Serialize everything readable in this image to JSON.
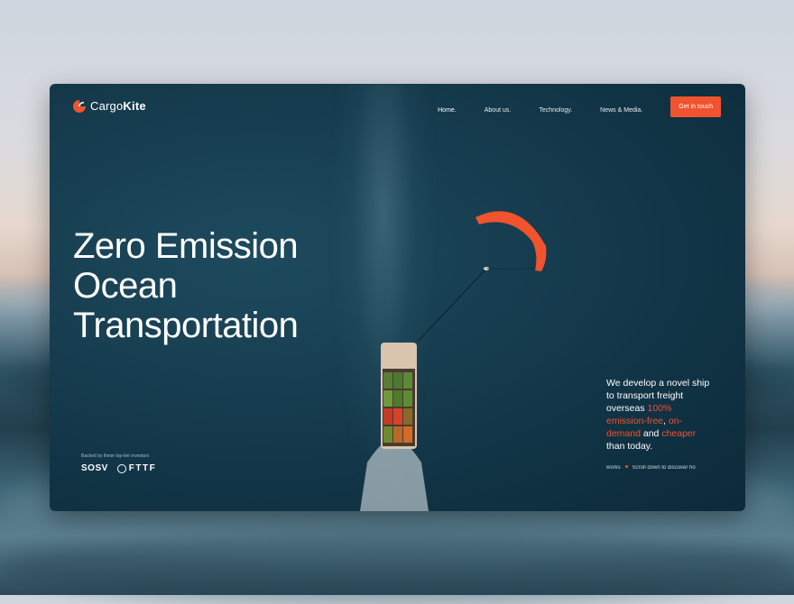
{
  "brand": {
    "name_light": "Cargo",
    "name_bold": "Kite",
    "icon": "cargokite-logo-icon",
    "accent": "#f0532e"
  },
  "nav": {
    "items": [
      {
        "label": "Home.",
        "active": true
      },
      {
        "label": "About us.",
        "active": false
      },
      {
        "label": "Technology.",
        "active": false
      },
      {
        "label": "News & Media.",
        "active": false
      }
    ],
    "cta": "Get in touch"
  },
  "hero": {
    "lines": [
      "Zero Emission",
      "Ocean",
      "Transportation"
    ]
  },
  "intro": {
    "part1": "We develop a novel ship to transport freight overseas ",
    "hl1": "100% emission-free",
    "sep1": ", ",
    "hl2": "on-demand",
    "sep2": " and ",
    "hl3": "cheaper",
    "part2": " than today."
  },
  "scroll": {
    "left": "works",
    "right": "Scroll down to discover ho"
  },
  "investors": {
    "caption": "Backed by these top-tier investors",
    "logos": [
      "SOSV",
      "FTTF"
    ]
  },
  "colors": {
    "ocean": "#0f3142",
    "kite": "#f0532e",
    "cta": "#f0532e"
  }
}
